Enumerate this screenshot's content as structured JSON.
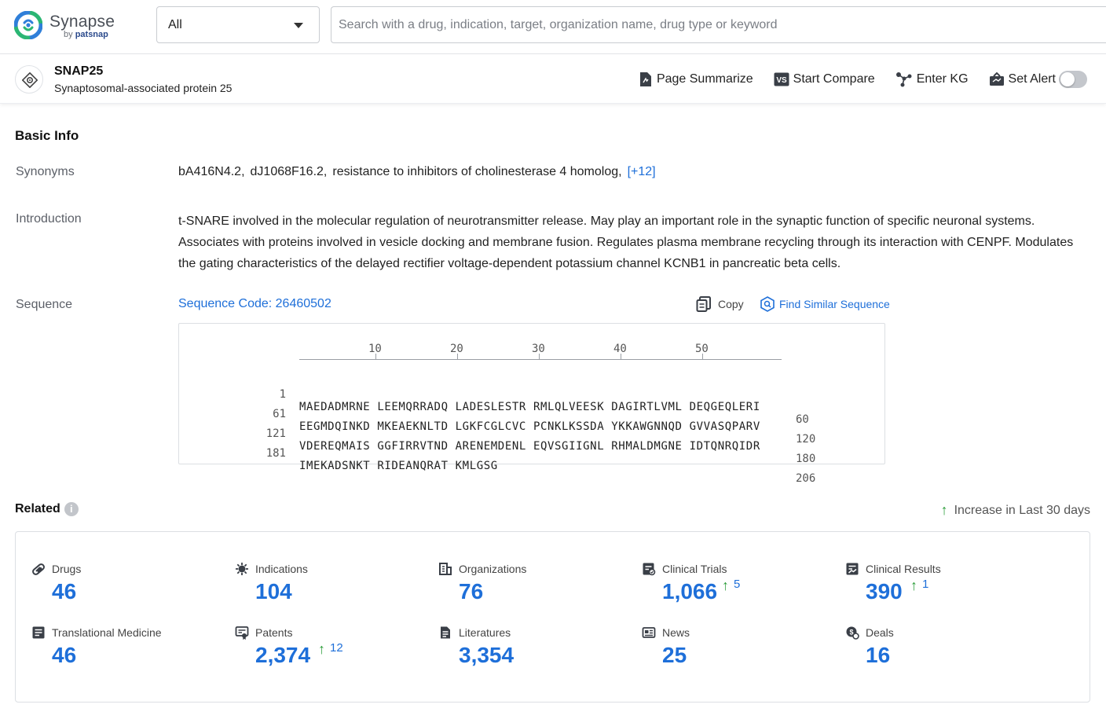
{
  "brand": {
    "name": "Synapse",
    "by": "by",
    "company": "patsnap"
  },
  "search": {
    "scope": "All",
    "placeholder": "Search with a drug, indication, target, organization name, drug type or keyword"
  },
  "header": {
    "title": "SNAP25",
    "subtitle": "Synaptosomal-associated protein 25",
    "actions": {
      "summarize": "Page Summarize",
      "compare": "Start Compare",
      "kg": "Enter KG",
      "alert": "Set Alert"
    },
    "alert_on": false
  },
  "basic_info": {
    "title": "Basic Info",
    "synonyms_label": "Synonyms",
    "synonyms": [
      "bA416N4.2,",
      "dJ1068F16.2,",
      "resistance to inhibitors of cholinesterase 4 homolog,"
    ],
    "synonyms_more": "[+12]",
    "intro_label": "Introduction",
    "intro": "t-SNARE involved in the molecular regulation of neurotransmitter release. May play an important role in the synaptic function of specific neuronal systems. Associates with proteins involved in vesicle docking and membrane fusion. Regulates plasma membrane recycling through its interaction with CENPF. Modulates the gating characteristics of the delayed rectifier voltage-dependent potassium channel KCNB1 in pancreatic beta cells.",
    "sequence_label": "Sequence",
    "sequence_code": "Sequence Code: 26460502",
    "copy_label": "Copy",
    "find_label": "Find Similar Sequence",
    "ruler_ticks": [
      "10",
      "20",
      "30",
      "40",
      "50"
    ],
    "rows": [
      {
        "start": "1",
        "residues": "MAEDADMRNE LEEMQRRADQ LADESLESTR RMLQLVEESK DAGIRTLVML DEQGEQLERI",
        "end": "60"
      },
      {
        "start": "61",
        "residues": "EEGMDQINKD MKEAEKNLTD LGKFCGLCVC PCNKLKSSDA YKKAWGNNQD GVVASQPARV",
        "end": "120"
      },
      {
        "start": "121",
        "residues": "VDEREQMAIS GGFIRRVTND ARENEMDENL EQVSGIIGNL RHMALDMGNE IDTQNRQIDR",
        "end": "180"
      },
      {
        "start": "181",
        "residues": "IMEKADSNKT RIDEANQRAT KMLGSG",
        "end": "206"
      }
    ]
  },
  "related": {
    "title": "Related",
    "info": "i",
    "legend": "Increase in Last 30 days",
    "stats": [
      {
        "label": "Drugs",
        "value": "46",
        "increase": ""
      },
      {
        "label": "Indications",
        "value": "104",
        "increase": ""
      },
      {
        "label": "Organizations",
        "value": "76",
        "increase": ""
      },
      {
        "label": "Clinical Trials",
        "value": "1,066",
        "increase": "5"
      },
      {
        "label": "Clinical Results",
        "value": "390",
        "increase": "1"
      },
      {
        "label": "Translational Medicine",
        "value": "46",
        "increase": ""
      },
      {
        "label": "Patents",
        "value": "2,374",
        "increase": "12"
      },
      {
        "label": "Literatures",
        "value": "3,354",
        "increase": ""
      },
      {
        "label": "News",
        "value": "25",
        "increase": ""
      },
      {
        "label": "Deals",
        "value": "16",
        "increase": ""
      }
    ]
  },
  "colors": {
    "accent": "#1e6fd9",
    "increase": "#2e9e3c",
    "logo_green": "#2bb673",
    "logo_blue": "#2f7fd9"
  },
  "icons": {
    "drugs": "pill-icon",
    "indications": "virus-icon",
    "organizations": "building-icon",
    "clinical_trials": "trial-icon",
    "clinical_results": "results-icon",
    "translational_medicine": "medicine-icon",
    "patents": "patent-icon",
    "literatures": "document-icon",
    "news": "news-icon",
    "deals": "deal-icon"
  }
}
